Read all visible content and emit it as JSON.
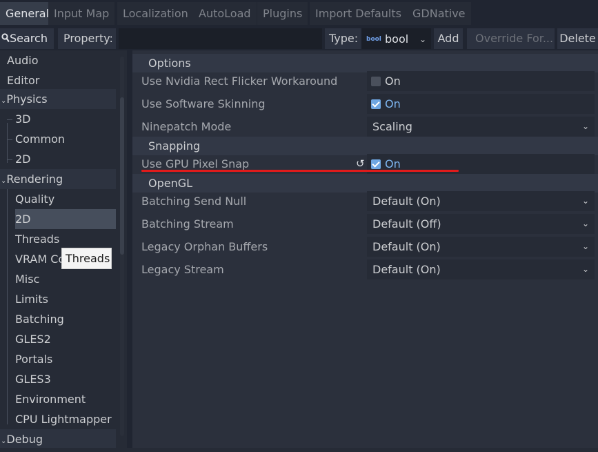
{
  "tabs": [
    {
      "label": "General",
      "active": true
    },
    {
      "label": "Input Map",
      "active": false
    },
    {
      "label": "Localization",
      "active": false
    },
    {
      "label": "AutoLoad",
      "active": false
    },
    {
      "label": "Plugins",
      "active": false
    },
    {
      "label": "Import Defaults",
      "active": false
    },
    {
      "label": "GDNative",
      "active": false
    }
  ],
  "toolbar": {
    "search_label": "Search",
    "property_label": "Property:",
    "property_value": "",
    "type_label": "Type:",
    "type_badge": "bool",
    "type_value": "bool",
    "add_label": "Add",
    "override_label": "Override For...",
    "delete_label": "Delete"
  },
  "tree": {
    "items": [
      {
        "label": "Audio",
        "level": 0,
        "category": false
      },
      {
        "label": "Editor",
        "level": 0,
        "category": false
      },
      {
        "label": "Physics",
        "level": 0,
        "category": true
      },
      {
        "label": "3D",
        "level": 1
      },
      {
        "label": "Common",
        "level": 1
      },
      {
        "label": "2D",
        "level": 1
      },
      {
        "label": "Rendering",
        "level": 0,
        "category": true
      },
      {
        "label": "Quality",
        "level": 1
      },
      {
        "label": "2D",
        "level": 1,
        "selected": true
      },
      {
        "label": "Threads",
        "level": 1
      },
      {
        "label": "VRAM Co",
        "level": 1
      },
      {
        "label": "Misc",
        "level": 1
      },
      {
        "label": "Limits",
        "level": 1
      },
      {
        "label": "Batching",
        "level": 1
      },
      {
        "label": "GLES2",
        "level": 1
      },
      {
        "label": "Portals",
        "level": 1
      },
      {
        "label": "GLES3",
        "level": 1
      },
      {
        "label": "Environment",
        "level": 1
      },
      {
        "label": "CPU Lightmapper",
        "level": 1
      },
      {
        "label": "Debug",
        "level": 0,
        "category": true
      }
    ]
  },
  "tooltip": "Threads",
  "sections": {
    "options": "Options",
    "snapping": "Snapping",
    "opengl": "OpenGL"
  },
  "properties": {
    "nvidia_flicker": {
      "label": "Use Nvidia Rect Flicker Workaround",
      "value": "On",
      "checked": false
    },
    "software_skinning": {
      "label": "Use Software Skinning",
      "value": "On",
      "checked": true
    },
    "ninepatch_mode": {
      "label": "Ninepatch Mode",
      "value": "Scaling"
    },
    "gpu_pixel_snap": {
      "label": "Use GPU Pixel Snap",
      "value": "On",
      "checked": true
    },
    "batching_send_null": {
      "label": "Batching Send Null",
      "value": "Default (On)"
    },
    "batching_stream": {
      "label": "Batching Stream",
      "value": "Default (Off)"
    },
    "legacy_orphan_buffers": {
      "label": "Legacy Orphan Buffers",
      "value": "Default (On)"
    },
    "legacy_stream": {
      "label": "Legacy Stream",
      "value": "Default (On)"
    }
  },
  "colors": {
    "accent": "#7fb7f2",
    "highlight_underline": "#e11b1b"
  }
}
